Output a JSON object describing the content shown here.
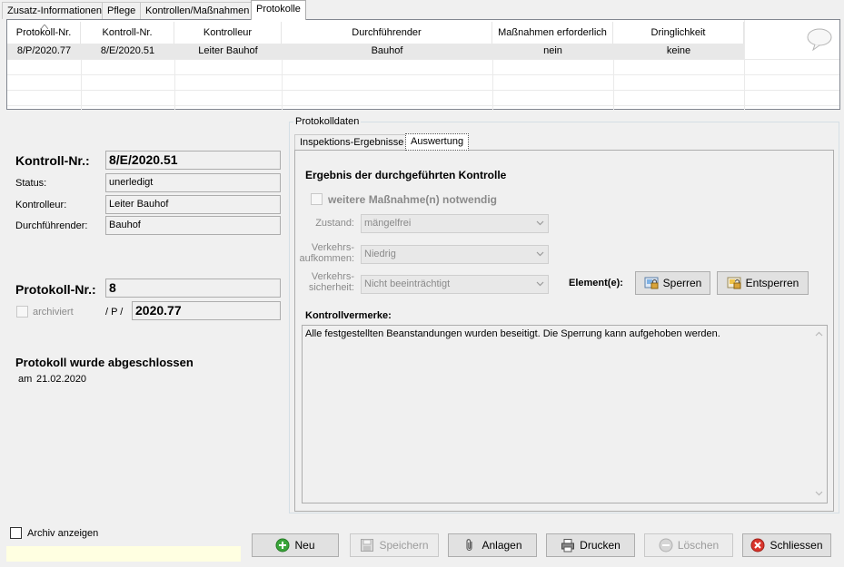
{
  "top_tabs": [
    "Zusatz-Informationen",
    "Pflege",
    "Kontrollen/Maßnahmen",
    "Protokolle"
  ],
  "grid": {
    "headers": [
      "Protokoll-Nr.",
      "Kontroll-Nr.",
      "Kontrolleur",
      "Durchführender",
      "Maßnahmen erforderlich",
      "Dringlichkeit"
    ],
    "rows": [
      [
        "8/P/2020.77",
        "8/E/2020.51",
        "Leiter Bauhof",
        "Bauhof",
        "nein",
        "keine"
      ]
    ]
  },
  "left": {
    "kontroll_label": "Kontroll-Nr.:",
    "kontroll_value": "8/E/2020.51",
    "status_label": "Status:",
    "status_value": "unerledigt",
    "kontrolleur_label": "Kontrolleur:",
    "kontrolleur_value": "Leiter Bauhof",
    "durch_label": "Durchführender:",
    "durch_value": "Bauhof",
    "protokoll_label": "Protokoll-Nr.:",
    "protokoll_value": "8",
    "archiviert_label": "archiviert",
    "sep_label": "/ P /",
    "protokoll_suffix": "2020.77",
    "abgeschlossen_text": "Protokoll wurde abgeschlossen",
    "am_label": "am",
    "am_date": "21.02.2020"
  },
  "group": {
    "title": "Protokolldaten",
    "tabs": [
      "Inspektions-Ergebnisse",
      "Auswertung"
    ],
    "ergebnis_title": "Ergebnis der durchgeführten Kontrolle",
    "weitere_label": "weitere Maßnahme(n) notwendig",
    "zustand_label": "Zustand:",
    "zustand_value": "mängelfrei",
    "verkehrsaufkommen_label1": "Verkehrs-",
    "verkehrsaufkommen_label2": "aufkommen:",
    "verkehrsaufkommen_value": "Niedrig",
    "verkehrssicherheit_label1": "Verkehrs-",
    "verkehrssicherheit_label2": "sicherheit:",
    "verkehrssicherheit_value": "Nicht beeinträchtigt",
    "elemente_label": "Element(e):",
    "sperren_label": "Sperren",
    "entsperren_label": "Entsperren",
    "vermerke_label": "Kontrollvermerke:",
    "vermerke_text": "Alle festgestellten Beanstandungen wurden beseitigt. Die Sperrung kann aufgehoben werden."
  },
  "bottom": {
    "archiv_label": "Archiv anzeigen",
    "neu": "Neu",
    "speichern": "Speichern",
    "anlagen": "Anlagen",
    "drucken": "Drucken",
    "loeschen": "Löschen",
    "schliessen": "Schliessen"
  },
  "colors": {
    "note_bar": "#ffffe1",
    "add_icon": "#3aa53a",
    "close_icon": "#d9342b"
  }
}
